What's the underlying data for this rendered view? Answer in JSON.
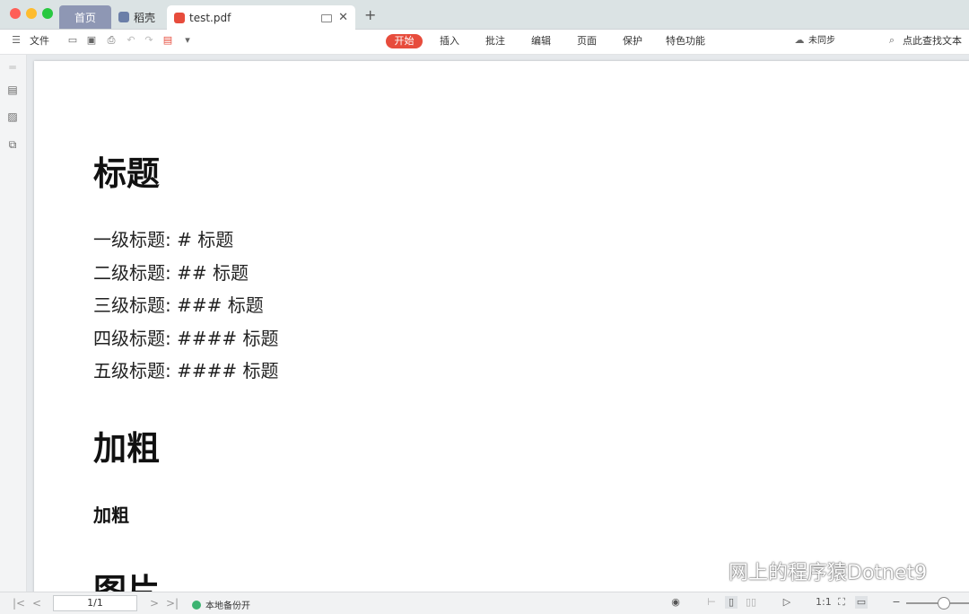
{
  "tabs": {
    "home": "首页",
    "shell": "稻壳",
    "doc": "test.pdf"
  },
  "toolbar": {
    "file": "文件",
    "menus": [
      "开始",
      "插入",
      "批注",
      "编辑",
      "页面",
      "保护",
      "特色功能"
    ],
    "sync": "未同步",
    "search": "点此查找文本"
  },
  "document": {
    "h_title": "标题",
    "lines": [
      "一级标题: # 标题",
      "二级标题: ## 标题",
      "三级标题: ### 标题",
      "四级标题: #### 标题",
      "五级标题: #### 标题"
    ],
    "h_bold": "加粗",
    "bold_text": "加粗",
    "h_image": "图片"
  },
  "watermark": "网上的程序猿Dotnet9",
  "status": {
    "page": "1/1",
    "backup": "本地备份开"
  }
}
